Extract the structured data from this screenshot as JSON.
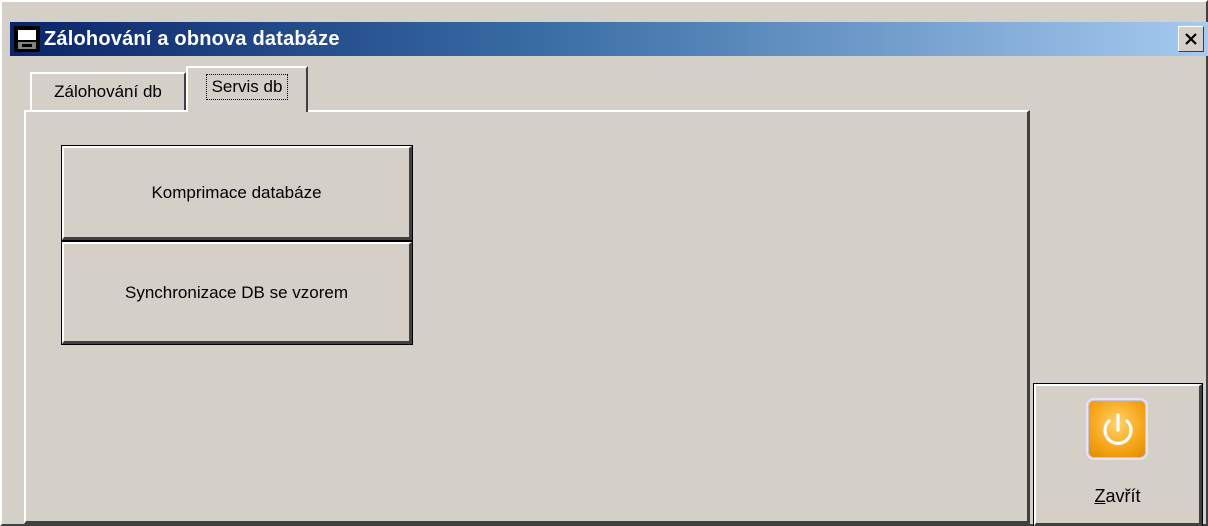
{
  "window": {
    "title": "Zálohování a obnova databáze"
  },
  "tabs": [
    {
      "label": "Zálohování db",
      "active": false
    },
    {
      "label": "Servis db",
      "active": true
    }
  ],
  "panel": {
    "buttons": [
      {
        "label": "Komprimace databáze"
      },
      {
        "label": "Synchronizace DB se vzorem"
      }
    ]
  },
  "close_button": {
    "mnemonic": "Z",
    "rest": "avřít",
    "icon": "power-icon"
  },
  "icons": {
    "app": "database-window-icon",
    "titlebar_close": "close-x-icon"
  },
  "colors": {
    "face": "#d4d0c8",
    "title_start": "#0a246a",
    "title_end": "#a6caf0",
    "power_orange": "#f6a51a"
  }
}
